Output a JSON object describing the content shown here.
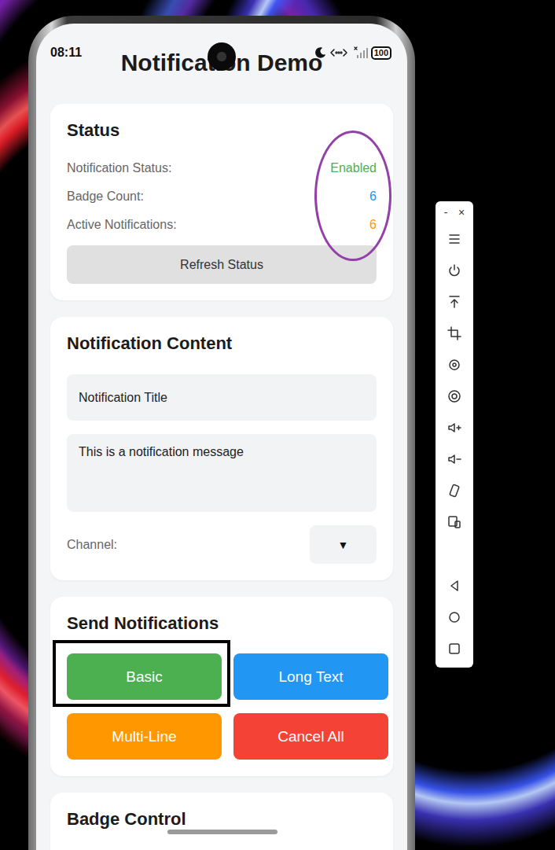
{
  "status_bar": {
    "time": "08:11",
    "battery": "100"
  },
  "title": "Notification Demo",
  "status": {
    "heading": "Status",
    "values_circled": true,
    "rows": [
      {
        "label": "Notification Status:",
        "value": "Enabled",
        "color": "#4caf50"
      },
      {
        "label": "Badge Count:",
        "value": "6",
        "color": "#2196f3"
      },
      {
        "label": "Active Notifications:",
        "value": "6",
        "color": "#ff9800"
      }
    ],
    "refresh_button": "Refresh Status"
  },
  "content": {
    "heading": "Notification Content",
    "title_field": "Notification Title",
    "message_field": "This is a notification message",
    "channel_label": "Channel:",
    "channel_arrow": "▼"
  },
  "send": {
    "heading": "Send Notifications",
    "buttons": [
      {
        "label": "Basic",
        "color": "#4caf50",
        "highlighted": true
      },
      {
        "label": "Long Text",
        "color": "#2196f3",
        "highlighted": false
      },
      {
        "label": "Multi-Line",
        "color": "#ff9800",
        "highlighted": false
      },
      {
        "label": "Cancel All",
        "color": "#f44336",
        "highlighted": false
      }
    ]
  },
  "badge": {
    "heading": "Badge Control"
  },
  "toolbar": {
    "minimize": "-",
    "close": "×"
  }
}
